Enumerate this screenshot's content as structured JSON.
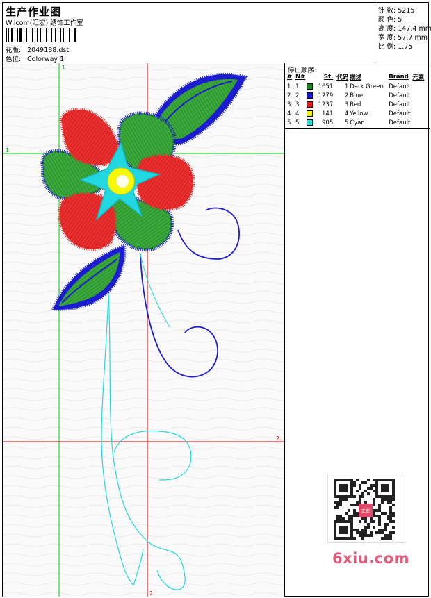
{
  "header": {
    "title": "生产作业图",
    "subtitle": "Wilcom(汇宏) 绣饰工作室",
    "design_label": "花版:",
    "design_value": "2049188.dst",
    "colorway_label": "色位:",
    "colorway_value": "Colorway 1"
  },
  "stats": {
    "stitches_label": "针 数:",
    "stitches_value": "5215",
    "colors_label": "颜 色:",
    "colors_value": "5",
    "height_label": "高 度:",
    "height_value": "147.4 mm",
    "width_label": "宽 度:",
    "width_value": "57.7 mm",
    "scale_label": "比 例:",
    "scale_value": "1.75"
  },
  "sequence": {
    "title": "停止顺序:",
    "columns": [
      "#",
      "N#",
      "St.",
      "代码",
      "描述",
      "Brand",
      "元素"
    ],
    "rows": [
      {
        "idx": "1.",
        "n": "1",
        "color": "#1a8a1a",
        "st": "1651",
        "code": "1",
        "desc": "Dark Green",
        "brand": "Default"
      },
      {
        "idx": "2.",
        "n": "2",
        "color": "#1818d8",
        "st": "1279",
        "code": "2",
        "desc": "Blue",
        "brand": "Default"
      },
      {
        "idx": "3.",
        "n": "3",
        "color": "#e81818",
        "st": "1237",
        "code": "3",
        "desc": "Red",
        "brand": "Default"
      },
      {
        "idx": "4.",
        "n": "4",
        "color": "#f4f400",
        "st": "141",
        "code": "4",
        "desc": "Yellow",
        "brand": "Default"
      },
      {
        "idx": "5.",
        "n": "5",
        "color": "#20e0e0",
        "st": "905",
        "code": "5",
        "desc": "Cyan",
        "brand": "Default"
      }
    ]
  },
  "guides": {
    "label_1": "1",
    "label_2": "2"
  },
  "colors": {
    "guide_green": "#00cc00",
    "guide_red": "#dd0000",
    "green": "#2e9a2e",
    "blue": "#1c1cd0",
    "red": "#e82828",
    "yellow": "#f8f800",
    "cyan": "#22d8e0"
  },
  "qr": {
    "stamp_text": "汇宏刺绣"
  },
  "watermark": {
    "text": "6xiu.com"
  }
}
